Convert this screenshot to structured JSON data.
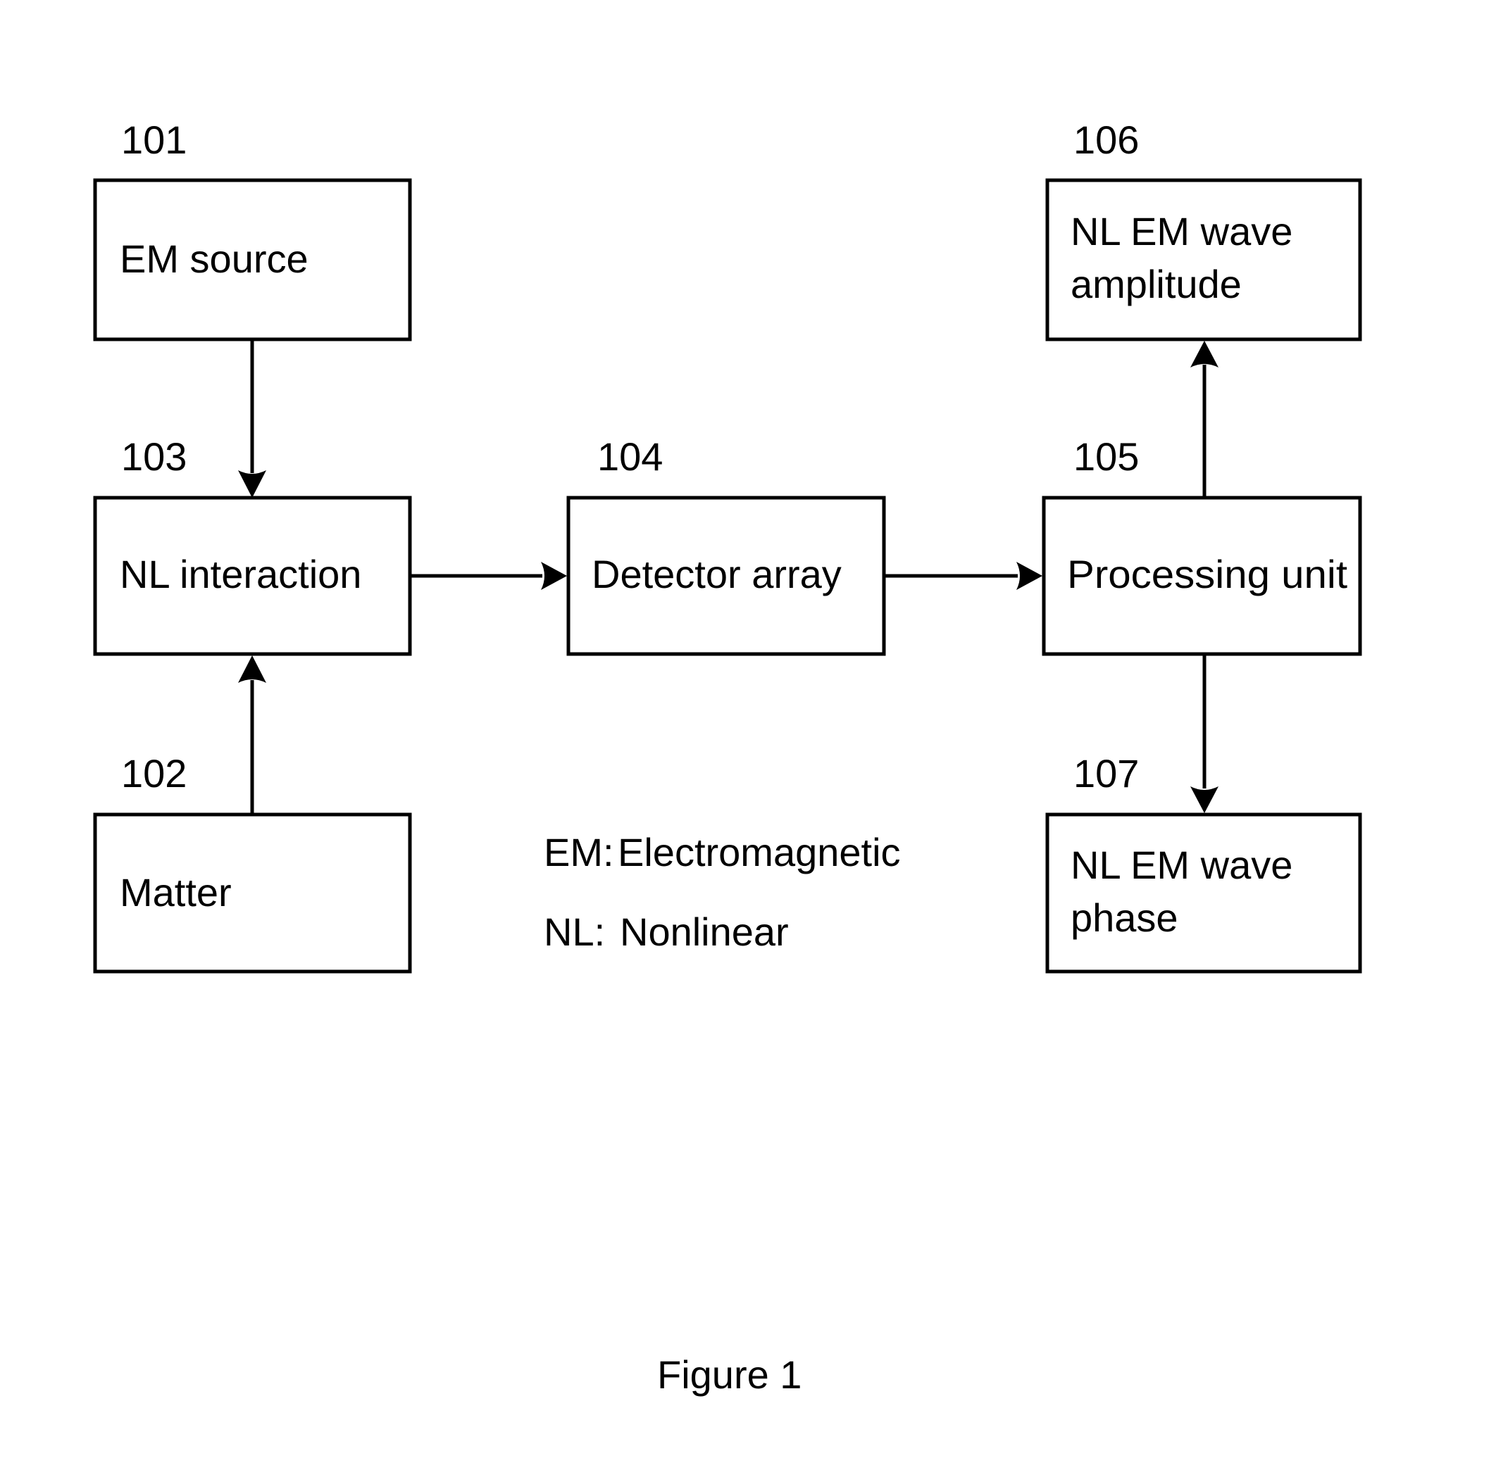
{
  "figure": {
    "caption": "Figure 1",
    "nodes": [
      {
        "id": "101",
        "ref": "101",
        "lines": [
          "EM source"
        ]
      },
      {
        "id": "102",
        "ref": "102",
        "lines": [
          "Matter"
        ]
      },
      {
        "id": "103",
        "ref": "103",
        "lines": [
          "NL interaction"
        ]
      },
      {
        "id": "104",
        "ref": "104",
        "lines": [
          "Detector array"
        ]
      },
      {
        "id": "105",
        "ref": "105",
        "lines": [
          "Processing unit"
        ]
      },
      {
        "id": "106",
        "ref": "106",
        "lines": [
          "NL EM wave",
          "amplitude"
        ]
      },
      {
        "id": "107",
        "ref": "107",
        "lines": [
          "NL EM wave",
          "phase"
        ]
      }
    ],
    "edges": [
      {
        "from": "101",
        "to": "103"
      },
      {
        "from": "102",
        "to": "103"
      },
      {
        "from": "103",
        "to": "104"
      },
      {
        "from": "104",
        "to": "105"
      },
      {
        "from": "105",
        "to": "106"
      },
      {
        "from": "105",
        "to": "107"
      }
    ],
    "legend": [
      {
        "abbr": "EM:",
        "meaning": "Electromagnetic"
      },
      {
        "abbr": "NL:",
        "meaning": "Nonlinear"
      }
    ]
  }
}
